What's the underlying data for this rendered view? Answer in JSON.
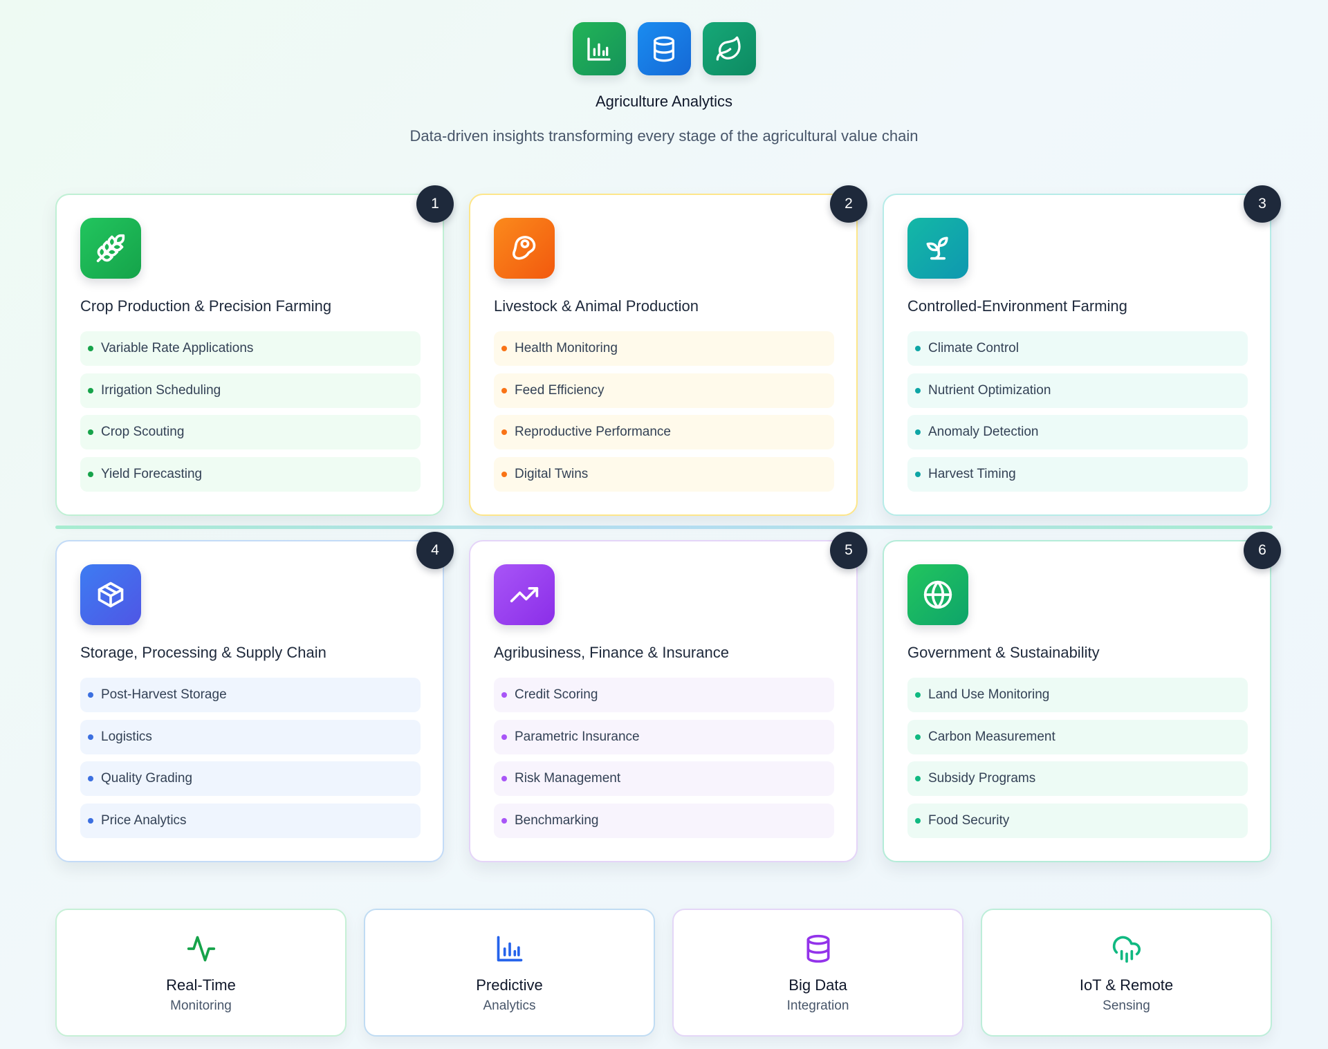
{
  "header": {
    "icons": [
      {
        "name": "bar-chart-icon",
        "color": "#16a34a"
      },
      {
        "name": "database-icon",
        "color": "#1d7fe6"
      },
      {
        "name": "leaf-icon",
        "color": "#0f9a6e"
      }
    ],
    "title": "Agriculture Analytics",
    "subtitle": "Data-driven insights transforming every stage of the agricultural value chain"
  },
  "cards": [
    {
      "number": "1",
      "title": "Crop Production & Precision Farming",
      "icon": "wheat-icon",
      "accent": "#16a34a",
      "items": [
        "Variable Rate Applications",
        "Irrigation Scheduling",
        "Crop Scouting",
        "Yield Forecasting"
      ]
    },
    {
      "number": "2",
      "title": "Livestock & Animal Production",
      "icon": "steak-icon",
      "accent": "#f97316",
      "items": [
        "Health Monitoring",
        "Feed Efficiency",
        "Reproductive Performance",
        "Digital Twins"
      ]
    },
    {
      "number": "3",
      "title": "Controlled-Environment Farming",
      "icon": "sprout-icon",
      "accent": "#0ea5a5",
      "items": [
        "Climate Control",
        "Nutrient Optimization",
        "Anomaly Detection",
        "Harvest Timing"
      ]
    },
    {
      "number": "4",
      "title": "Storage, Processing & Supply Chain",
      "icon": "package-icon",
      "accent": "#3b82f6",
      "items": [
        "Post-Harvest Storage",
        "Logistics",
        "Quality Grading",
        "Price Analytics"
      ]
    },
    {
      "number": "5",
      "title": "Agribusiness, Finance & Insurance",
      "icon": "trending-up-icon",
      "accent": "#a855f7",
      "items": [
        "Credit Scoring",
        "Parametric Insurance",
        "Risk Management",
        "Benchmarking"
      ]
    },
    {
      "number": "6",
      "title": "Government & Sustainability",
      "icon": "globe-icon",
      "accent": "#10b981",
      "items": [
        "Land Use Monitoring",
        "Carbon Measurement",
        "Subsidy Programs",
        "Food Security"
      ]
    }
  ],
  "features": [
    {
      "title": "Real-Time",
      "subtitle": "Monitoring",
      "icon": "activity-icon",
      "color": "#16a34a"
    },
    {
      "title": "Predictive",
      "subtitle": "Analytics",
      "icon": "bar-chart-icon",
      "color": "#2563eb"
    },
    {
      "title": "Big Data",
      "subtitle": "Integration",
      "icon": "database-icon",
      "color": "#9333ea"
    },
    {
      "title": "IoT & Remote",
      "subtitle": "Sensing",
      "icon": "cloud-rain-icon",
      "color": "#10b981"
    }
  ]
}
